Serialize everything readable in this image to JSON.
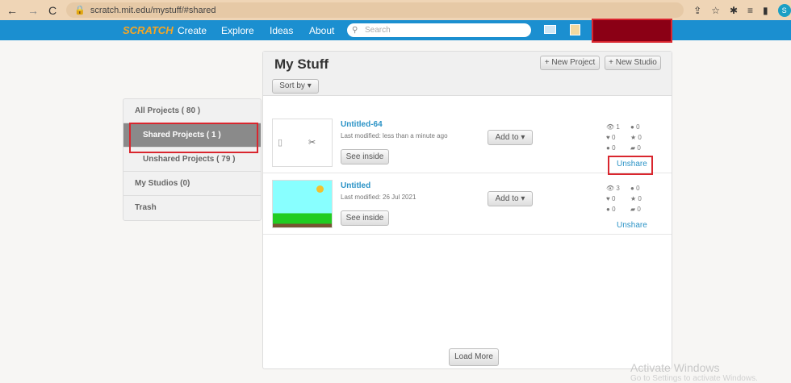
{
  "browser": {
    "url": "scratch.mit.edu/mystuff/#shared",
    "profile_initial": "S"
  },
  "nav": {
    "logo": "SCRATCH",
    "items": [
      "Create",
      "Explore",
      "Ideas",
      "About"
    ],
    "search_placeholder": "Search"
  },
  "sidebar": {
    "items": [
      "All Projects ( 80 )",
      "Shared Projects ( 1 )",
      "Unshared Projects ( 79 )",
      "My Studios (0)",
      "Trash"
    ]
  },
  "main": {
    "title": "My Stuff",
    "new_project": "+ New Project",
    "new_studio": "+ New Studio",
    "sort_by": "Sort by",
    "load_more": "Load More",
    "projects": [
      {
        "title": "Untitled-64",
        "modified": "Last modified: less than a minute ago",
        "see_inside": "See inside",
        "add_to": "Add to",
        "views": "1",
        "loves": "0",
        "comments": "0",
        "remixes_a": "0",
        "favorites": "0",
        "remixes": "0",
        "unshare": "Unshare"
      },
      {
        "title": "Untitled",
        "modified": "Last modified: 26 Jul 2021",
        "see_inside": "See inside",
        "add_to": "Add to",
        "views": "3",
        "loves": "0",
        "comments": "0",
        "remixes_a": "0",
        "favorites": "0",
        "remixes": "0",
        "unshare": "Unshare"
      }
    ]
  },
  "watermark": {
    "line1": "Activate Windows",
    "line2": "Go to Settings to activate Windows."
  },
  "colors": {
    "nav": "#1b8fd0",
    "highlight": "#d9262e",
    "link": "#2b93c6"
  }
}
